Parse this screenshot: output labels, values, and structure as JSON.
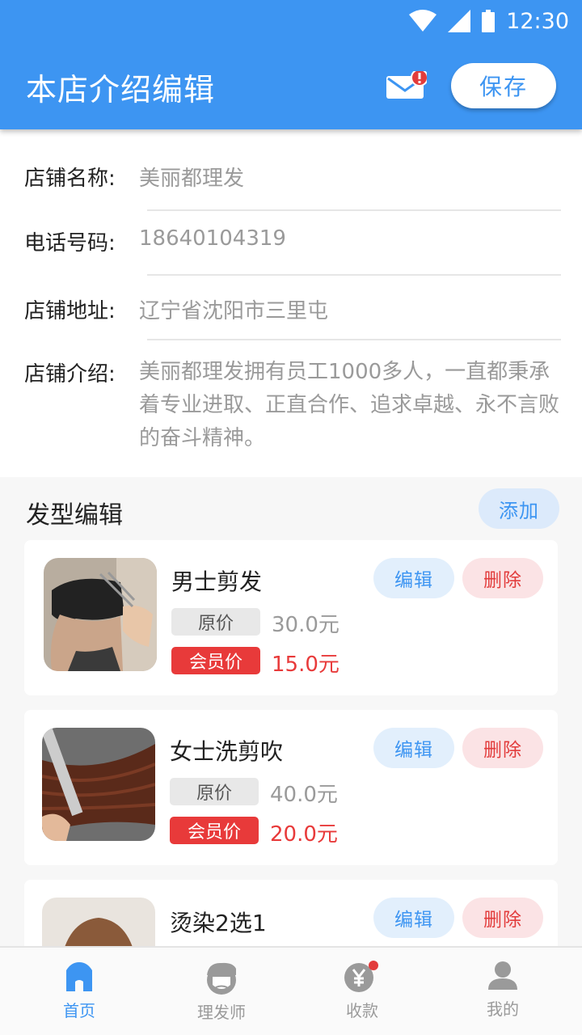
{
  "status_bar": {
    "time": "12:30"
  },
  "header": {
    "title": "本店介绍编辑",
    "save_label": "保存"
  },
  "shop": {
    "name_label": "店铺名称:",
    "name_value": "美丽都理发",
    "phone_label": "电话号码:",
    "phone_value": "18640104319",
    "address_label": "店铺地址:",
    "address_value": "辽宁省沈阳市三里屯",
    "intro_label": "店铺介绍:",
    "intro_value": "美丽都理发拥有员工1000多人，一直都秉承着专业进取、正直合作、追求卓越、永不言败的奋斗精神。"
  },
  "styles": {
    "title": "发型编辑",
    "add_label": "添加",
    "items": [
      {
        "name": "男士剪发",
        "orig_label": "原价",
        "orig_price": "30.0元",
        "member_label": "会员价",
        "member_price": "15.0元",
        "edit_label": "编辑",
        "delete_label": "删除"
      },
      {
        "name": "女士洗剪吹",
        "orig_label": "原价",
        "orig_price": "40.0元",
        "member_label": "会员价",
        "member_price": "20.0元",
        "edit_label": "编辑",
        "delete_label": "删除"
      },
      {
        "name": "烫染2选1",
        "edit_label": "编辑",
        "delete_label": "删除"
      }
    ]
  },
  "tabbar": {
    "items": [
      {
        "label": "首页",
        "icon": "home-icon",
        "active": true
      },
      {
        "label": "理发师",
        "icon": "barber-icon",
        "active": false
      },
      {
        "label": "收款",
        "icon": "yuan-icon",
        "active": false
      },
      {
        "label": "我的",
        "icon": "user-icon",
        "active": false
      }
    ]
  },
  "colors": {
    "primary": "#3d95f2",
    "danger": "#e83a3a",
    "muted": "#9a9a9a"
  }
}
